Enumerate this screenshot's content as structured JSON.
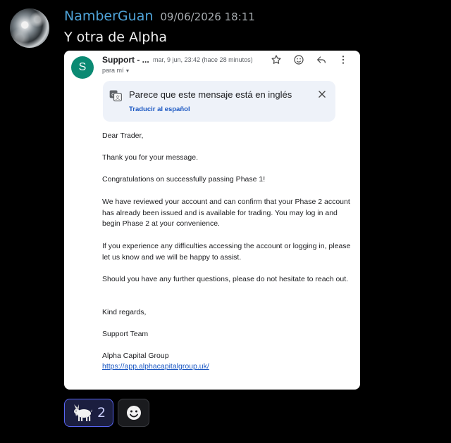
{
  "message": {
    "username": "NamberGuan",
    "timestamp": "09/06/2026 18:11",
    "text": "Y otra de Alpha",
    "username_color": "#4fa3d8"
  },
  "email": {
    "sender_initial": "S",
    "sender_name": "Support - ...",
    "sender_meta": "mar, 9 jun, 23:42 (hace 28 minutos)",
    "recipient": "para mí",
    "icons": [
      "star-icon",
      "emoji-icon",
      "reply-icon",
      "more-vert-icon"
    ],
    "translate_banner": {
      "title": "Parece que este mensaje está en inglés",
      "link": "Traducir al español"
    },
    "body": {
      "greeting": "Dear Trader,",
      "p1": "Thank you for your message.",
      "p2": "Congratulations on successfully passing Phase 1!",
      "p3": "We have reviewed your account and can confirm that your Phase 2 account has already been issued and is available for trading. You may log in and begin Phase 2 at your convenience.",
      "p4": "If you experience any difficulties accessing the account or logging in, please let us know and we will be happy to assist.",
      "p5": "Should you have any further questions, please do not hesitate to reach out.",
      "closing": "Kind regards,",
      "team": "Support Team",
      "company": "Alpha Capital Group",
      "link": "https://app.alphacapitalgroup.uk/"
    }
  },
  "reactions": [
    {
      "emoji": "goat",
      "count": "2"
    },
    {
      "emoji": "add-reaction",
      "count": ""
    }
  ]
}
